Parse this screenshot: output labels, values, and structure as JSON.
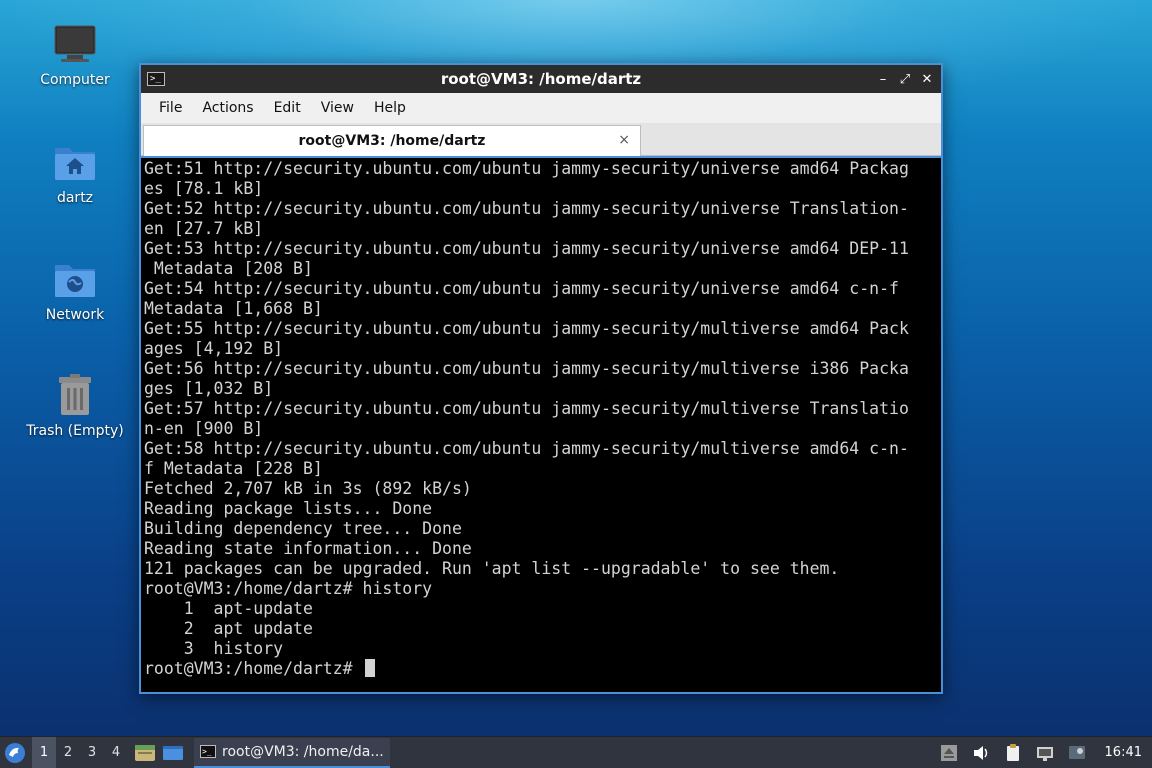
{
  "desktop": {
    "icons": [
      {
        "label": "Computer"
      },
      {
        "label": "dartz"
      },
      {
        "label": "Network"
      },
      {
        "label": "Trash (Empty)"
      }
    ]
  },
  "window": {
    "title": "root@VM3: /home/dartz",
    "app_icon_glyph": ">_",
    "controls": {
      "minimize": "–",
      "maximize": "⤢",
      "close": "✕"
    },
    "menu": [
      "File",
      "Actions",
      "Edit",
      "View",
      "Help"
    ],
    "tab": {
      "label": "root@VM3: /home/dartz",
      "close": "×"
    },
    "terminal": {
      "lines": [
        "Get:51 http://security.ubuntu.com/ubuntu jammy-security/universe amd64 Packag",
        "es [78.1 kB]",
        "Get:52 http://security.ubuntu.com/ubuntu jammy-security/universe Translation-",
        "en [27.7 kB]",
        "Get:53 http://security.ubuntu.com/ubuntu jammy-security/universe amd64 DEP-11",
        " Metadata [208 B]",
        "Get:54 http://security.ubuntu.com/ubuntu jammy-security/universe amd64 c-n-f",
        "Metadata [1,668 B]",
        "Get:55 http://security.ubuntu.com/ubuntu jammy-security/multiverse amd64 Pack",
        "ages [4,192 B]",
        "Get:56 http://security.ubuntu.com/ubuntu jammy-security/multiverse i386 Packa",
        "ges [1,032 B]",
        "Get:57 http://security.ubuntu.com/ubuntu jammy-security/multiverse Translatio",
        "n-en [900 B]",
        "Get:58 http://security.ubuntu.com/ubuntu jammy-security/multiverse amd64 c-n-",
        "f Metadata [228 B]",
        "Fetched 2,707 kB in 3s (892 kB/s)",
        "Reading package lists... Done",
        "Building dependency tree... Done",
        "Reading state information... Done",
        "121 packages can be upgraded. Run 'apt list --upgradable' to see them.",
        "root@VM3:/home/dartz# history",
        "    1  apt-update",
        "    2  apt update",
        "    3  history"
      ],
      "prompt": "root@VM3:/home/dartz# "
    }
  },
  "taskbar": {
    "workspaces": [
      "1",
      "2",
      "3",
      "4"
    ],
    "active_workspace": "1",
    "task_label": "root@VM3: /home/da...",
    "clock": "16:41",
    "accent": "#4a90d9"
  }
}
